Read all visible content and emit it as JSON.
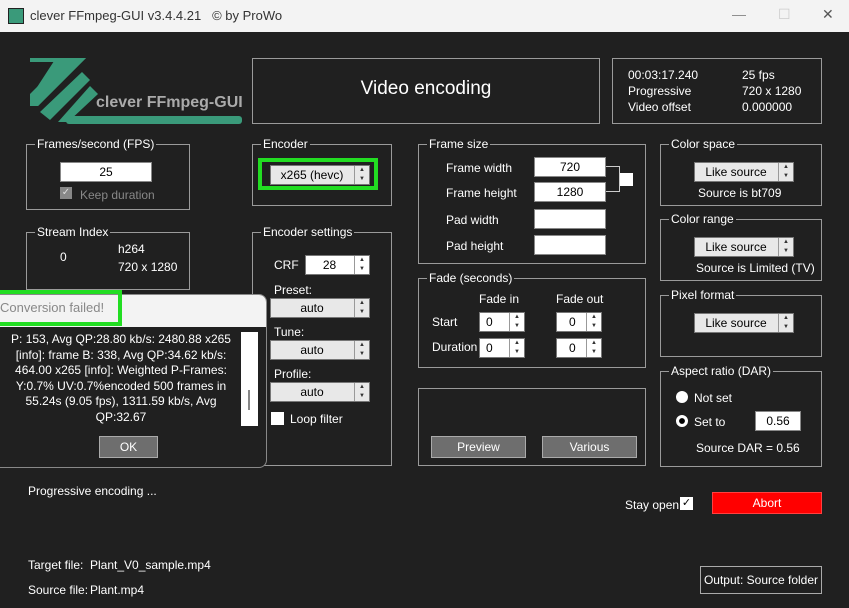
{
  "window": {
    "title": "clever FFmpeg-GUI v3.4.4.21",
    "copyright": "© by ProWo"
  },
  "logo": {
    "text": "clever FFmpeg-GUI"
  },
  "header": {
    "title": "Video encoding"
  },
  "info": {
    "duration": "00:03:17.240",
    "fps": "25 fps",
    "scan": "Progressive",
    "resolution": "720 x 1280",
    "offset_label": "Video offset",
    "offset": "0.000000"
  },
  "fps": {
    "label": "Frames/second (FPS)",
    "value": "25",
    "keep_duration": "Keep duration"
  },
  "stream": {
    "label": "Stream Index",
    "index": "0",
    "codec": "h264",
    "resolution": "720 x 1280"
  },
  "encoder": {
    "label": "Encoder",
    "value": "x265 (hevc)"
  },
  "encoder_settings": {
    "label": "Encoder settings",
    "crf_label": "CRF",
    "crf": "28",
    "preset_label": "Preset:",
    "preset": "auto",
    "tune_label": "Tune:",
    "tune": "auto",
    "profile_label": "Profile:",
    "profile": "auto",
    "loop_filter": "Loop filter"
  },
  "frame_size": {
    "label": "Frame size",
    "width_label": "Frame width",
    "width": "720",
    "height_label": "Frame height",
    "height": "1280",
    "pad_width_label": "Pad width",
    "pad_height_label": "Pad height"
  },
  "fade": {
    "label": "Fade (seconds)",
    "fade_in": "Fade in",
    "fade_out": "Fade out",
    "start": "Start",
    "duration": "Duration",
    "start_in": "0",
    "start_out": "0",
    "dur_in": "0",
    "dur_out": "0"
  },
  "actions": {
    "preview": "Preview",
    "various": "Various"
  },
  "color_space": {
    "label": "Color space",
    "value": "Like source",
    "source": "Source is bt709"
  },
  "color_range": {
    "label": "Color range",
    "value": "Like source",
    "source": "Source is Limited (TV)"
  },
  "pixel_format": {
    "label": "Pixel format",
    "value": "Like source"
  },
  "aspect": {
    "label": "Aspect ratio (DAR)",
    "not_set": "Not set",
    "set_to": "Set to",
    "value": "0.56",
    "source": "Source DAR = 0.56"
  },
  "status": {
    "text": "Progressive encoding ...",
    "stay_open": "Stay open",
    "abort": "Abort",
    "target_label": "Target file:",
    "target": "Plant_V0_sample.mp4",
    "source_label": "Source file:",
    "source": "Plant.mp4",
    "output": "Output: Source folder"
  },
  "dialog": {
    "title": "Conversion failed!",
    "message": "P:   153, Avg QP:28.80  kb/s: 2480.88 x265 [info]: frame B:    338, Avg QP:34.62  kb/s: 464.00  x265 [info]: Weighted P-Frames: Y:0.7% UV:0.7%encoded 500 frames in 55.24s (9.05 fps), 1311.59 kb/s, Avg QP:32.67",
    "ok": "OK"
  },
  "colors": {
    "accent": "#3a9a7a",
    "abort": "#ff0000",
    "highlight": "#22dd22"
  }
}
